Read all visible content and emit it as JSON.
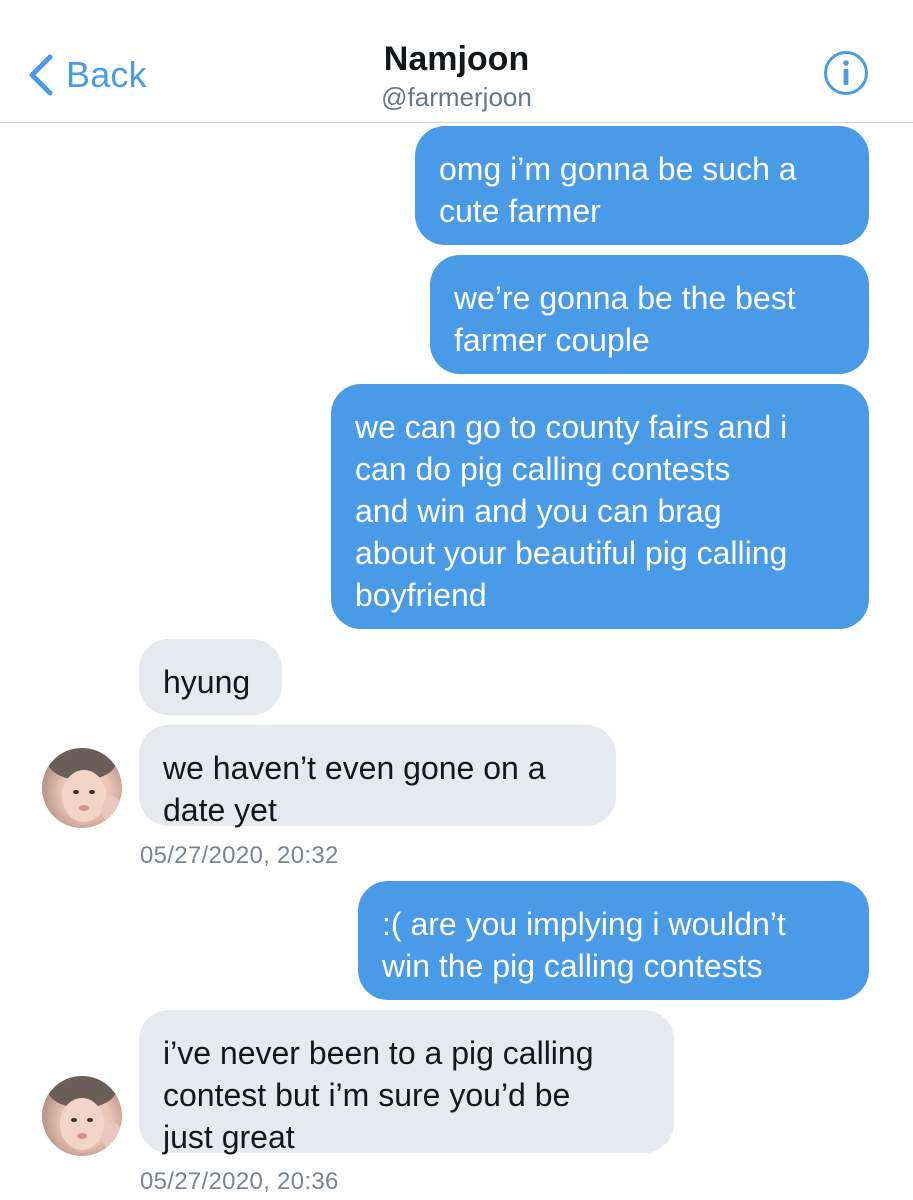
{
  "header": {
    "back_label": "Back",
    "name": "Namjoon",
    "handle": "@farmerjoon",
    "back_icon": "chevron-left-icon",
    "info_icon": "info-icon"
  },
  "messages": [
    {
      "direction": "outgoing",
      "text": "omg i’m gonna be such a\ncute farmer"
    },
    {
      "direction": "outgoing",
      "text": "we’re gonna be the best\nfarmer couple"
    },
    {
      "direction": "outgoing",
      "text": "we can go to county fairs and i\ncan do pig calling contests\nand win and you can brag\nabout your beautiful pig calling\nboyfriend"
    },
    {
      "direction": "incoming",
      "text": "hyung"
    },
    {
      "direction": "incoming",
      "text": "we haven’t even gone on a\ndate yet"
    },
    {
      "direction": "outgoing",
      "text": ":( are you implying i wouldn’t\nwin the pig calling contests"
    },
    {
      "direction": "incoming",
      "text": "i’ve never been to a pig calling\ncontest but i’m sure you’d be\njust great"
    }
  ],
  "timestamps": [
    "05/27/2020, 20:32",
    "05/27/2020, 20:36"
  ],
  "colors": {
    "accent": "#4a9be7",
    "incoming_bubble": "#e6e9ee",
    "timestamp": "#7b8591"
  }
}
